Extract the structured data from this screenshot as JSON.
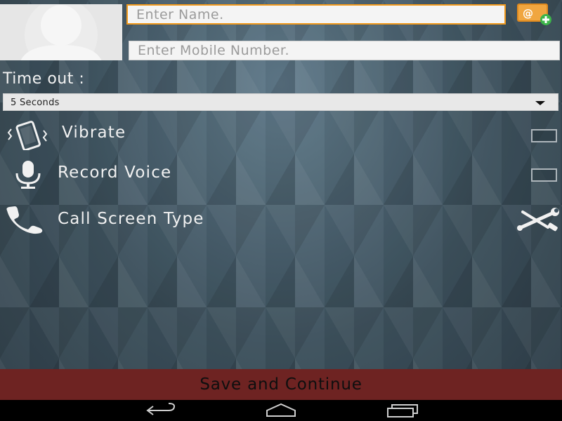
{
  "form": {
    "name_placeholder": "Enter Name.",
    "mobile_placeholder": "Enter Mobile Number.",
    "timeout_label": "Time out :",
    "timeout_value": "5 Seconds"
  },
  "options": [
    {
      "label": "Vibrate",
      "icon": "vibrate-phone-icon",
      "checked": false
    },
    {
      "label": "Record Voice",
      "icon": "microphone-icon",
      "checked": false
    },
    {
      "label": "Call Screen Type",
      "icon": "phone-handset-icon"
    }
  ],
  "actions": {
    "save_label": "Save and Continue"
  },
  "colors": {
    "accent_border": "#f29a1c",
    "save_bar": "#6e2322",
    "background": "#3b505d"
  },
  "icons": {
    "contact_picker": "contact-card-add-icon",
    "settings_tools": "wrench-screwdriver-icon",
    "nav": [
      "back-icon",
      "home-icon",
      "recent-apps-icon"
    ]
  }
}
